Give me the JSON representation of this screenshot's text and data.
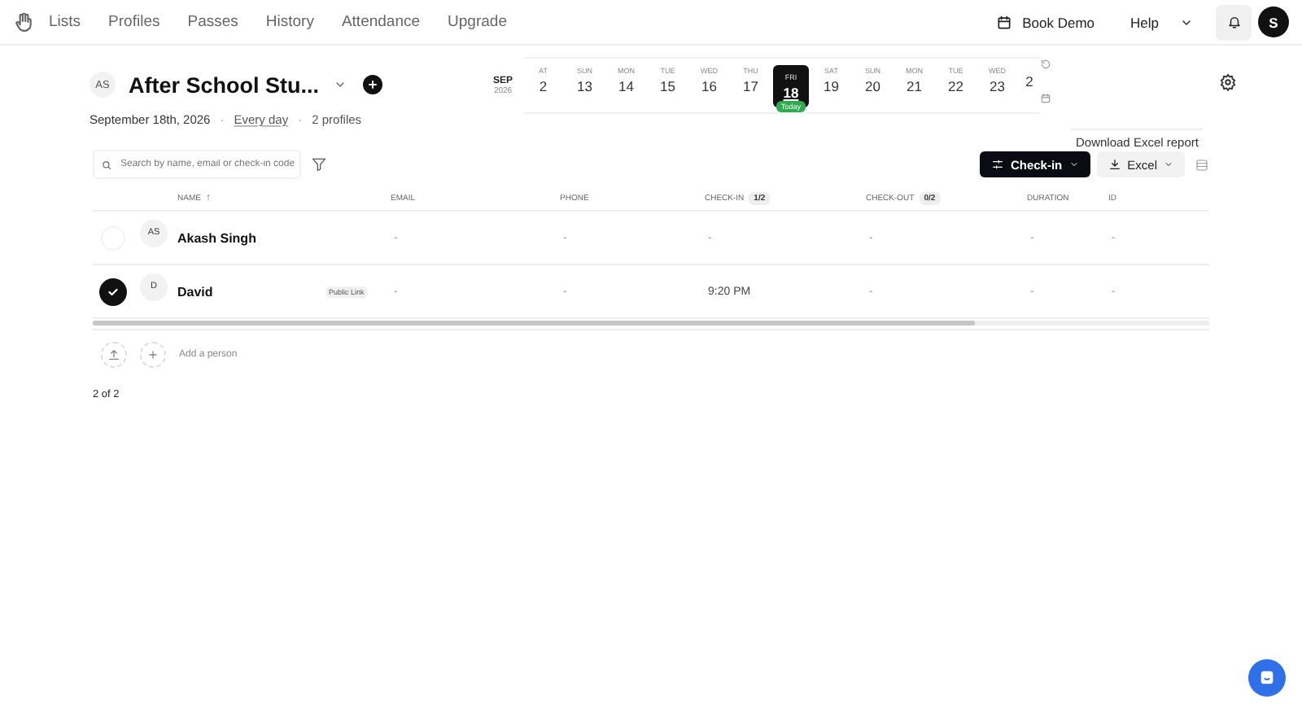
{
  "nav": {
    "items": [
      {
        "label": "Lists"
      },
      {
        "label": "Profiles"
      },
      {
        "label": "Passes"
      },
      {
        "label": "History"
      },
      {
        "label": "Attendance"
      },
      {
        "label": "Upgrade"
      }
    ],
    "book_demo": "Book Demo",
    "help": "Help",
    "avatar": "S"
  },
  "list": {
    "initials": "AS",
    "title": "After School Stu...",
    "date": "September 18th, 2026",
    "separator_1": "·",
    "repeat": "Every day",
    "separator_2": "·",
    "profiles": "2 profiles"
  },
  "date_strip": {
    "month": "SEP",
    "year": "2026",
    "days": [
      {
        "weekday": "AT",
        "day": "2",
        "selected": false
      },
      {
        "weekday": "SUN",
        "day": "13",
        "selected": false
      },
      {
        "weekday": "MON",
        "day": "14",
        "selected": false
      },
      {
        "weekday": "TUE",
        "day": "15",
        "selected": false
      },
      {
        "weekday": "WED",
        "day": "16",
        "selected": false
      },
      {
        "weekday": "THU",
        "day": "17",
        "selected": false
      },
      {
        "weekday": "FRI",
        "day": "18",
        "selected": true,
        "badge": "Today"
      },
      {
        "weekday": "SAT",
        "day": "19",
        "selected": false
      },
      {
        "weekday": "SUN",
        "day": "20",
        "selected": false
      },
      {
        "weekday": "MON",
        "day": "21",
        "selected": false
      },
      {
        "weekday": "TUE",
        "day": "22",
        "selected": false
      },
      {
        "weekday": "WED",
        "day": "23",
        "selected": false
      },
      {
        "day": "2",
        "selected": false
      }
    ]
  },
  "tooltip": "Download Excel report",
  "toolbar": {
    "search_placeholder": "Search by name, email or check-in code",
    "checkin_button": "Check-in",
    "excel_button": "Excel"
  },
  "table": {
    "columns": [
      {
        "label": "NAME",
        "sort_arrow": "↑"
      },
      {
        "label": "EMAIL"
      },
      {
        "label": "PHONE"
      },
      {
        "label": "CHECK-IN",
        "count": "1/2"
      },
      {
        "label": "CHECK-OUT",
        "count": "0/2"
      },
      {
        "label": "DURATION"
      },
      {
        "label": "ID"
      }
    ],
    "rows": [
      {
        "checked": false,
        "initials": "AS",
        "cells": [
          "Akash Singh",
          "-",
          "-",
          "-",
          "-",
          "-",
          "-"
        ]
      },
      {
        "checked": true,
        "initials": "D",
        "tag": "Public Link",
        "cells": [
          "David",
          "-",
          "-",
          "9:20 PM",
          "-",
          "-",
          "-"
        ]
      }
    ],
    "add_person": "Add a person",
    "count": "2 of 2"
  }
}
